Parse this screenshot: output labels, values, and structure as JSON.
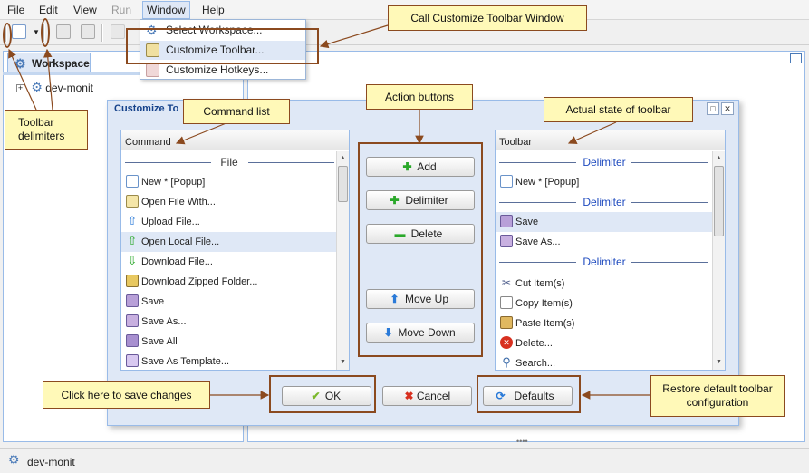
{
  "menubar": {
    "items": [
      "File",
      "Edit",
      "View",
      "Run",
      "Window",
      "Help"
    ]
  },
  "window_menu": {
    "items": [
      "Select Workspace...",
      "Customize Toolbar...",
      "Customize Hotkeys..."
    ]
  },
  "workspace": {
    "tab_label": "Workspace",
    "tree_item": "dev-monit"
  },
  "status_bar": {
    "label": "dev-monit"
  },
  "dialog": {
    "title": "Customize To",
    "command_list": {
      "header": "Command",
      "group_label": "File",
      "items": [
        "New * [Popup]",
        "Open File With...",
        "Upload File...",
        "Open Local File...",
        "Download File...",
        "Download Zipped Folder...",
        "Save",
        "Save As...",
        "Save All",
        "Save As Template..."
      ]
    },
    "toolbar_list": {
      "header": "Toolbar",
      "delimiter_label": "Delimiter",
      "items": [
        "New * [Popup]",
        "Save",
        "Save As...",
        "Cut Item(s)",
        "Copy Item(s)",
        "Paste Item(s)",
        "Delete...",
        "Search..."
      ]
    },
    "actions": {
      "add": "Add",
      "delimiter": "Delimiter",
      "delete": "Delete",
      "move_up": "Move Up",
      "move_down": "Move Down"
    },
    "footer": {
      "ok": "OK",
      "cancel": "Cancel",
      "defaults": "Defaults"
    }
  },
  "callouts": {
    "call_customize": "Call Customize Toolbar Window",
    "action_buttons": "Action buttons",
    "command_list": "Command list",
    "actual_state": "Actual state of toolbar",
    "toolbar_delimiters": "Toolbar delimiters",
    "save_changes": "Click here to save changes",
    "restore_default": "Restore default toolbar configuration"
  },
  "colors": {
    "accent": "#99bbe8",
    "callout_fill": "#fff9b8",
    "callout_border": "#8b4a1f",
    "delimiter_text": "#1f4bbf"
  }
}
